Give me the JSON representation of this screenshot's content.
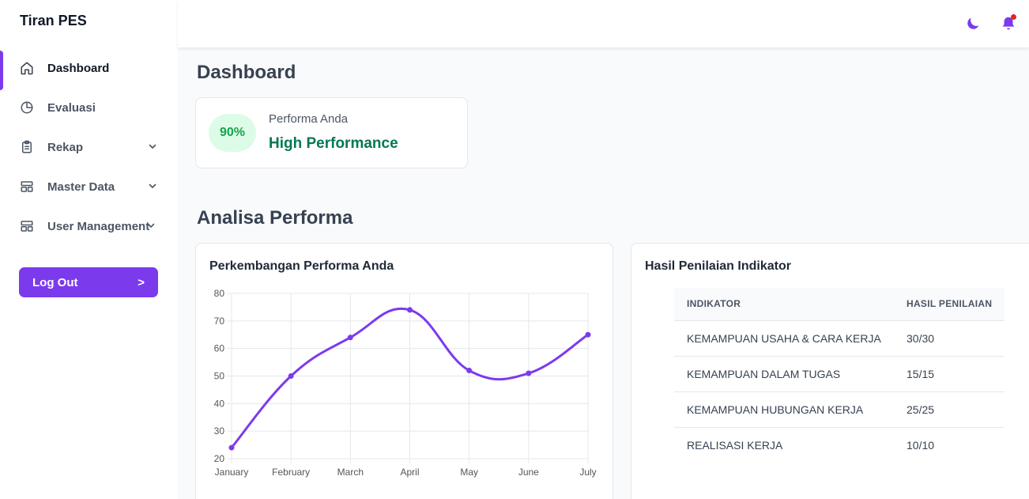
{
  "app": {
    "brand": "Tiran PES"
  },
  "sidebar": {
    "items": [
      {
        "label": "Dashboard",
        "icon": "home-icon",
        "active": true,
        "has_submenu": false
      },
      {
        "label": "Evaluasi",
        "icon": "pie-chart-icon",
        "active": false,
        "has_submenu": false
      },
      {
        "label": "Rekap",
        "icon": "clipboard-icon",
        "active": false,
        "has_submenu": true
      },
      {
        "label": "Master Data",
        "icon": "layout-icon",
        "active": false,
        "has_submenu": true
      },
      {
        "label": "User Management",
        "icon": "layout-icon",
        "active": false,
        "has_submenu": true
      }
    ],
    "logout_label": "Log Out",
    "logout_arrow": ">"
  },
  "topbar": {
    "icons": [
      "moon-icon",
      "bell-icon"
    ],
    "has_notification": true
  },
  "main": {
    "title": "Dashboard",
    "performance": {
      "badge": "90%",
      "label": "Performa Anda",
      "value": "High Performance"
    },
    "section_title": "Analisa Performa",
    "chart_card": {
      "title": "Perkembangan Performa Anda"
    },
    "table_card": {
      "title": "Hasil Penilaian Indikator",
      "headers": [
        "INDIKATOR",
        "HASIL PENILAIAN"
      ],
      "rows": [
        [
          "KEMAMPUAN USAHA & CARA KERJA",
          "30/30"
        ],
        [
          "KEMAMPUAN DALAM TUGAS",
          "15/15"
        ],
        [
          "KEMAMPUAN HUBUNGAN KERJA",
          "25/25"
        ],
        [
          "REALISASI KERJA",
          "10/10"
        ]
      ]
    }
  },
  "colors": {
    "accent": "#7c3aed",
    "success_bg": "#dcfce7",
    "success_text": "#16a34a",
    "notification": "#dc2626"
  },
  "chart_data": {
    "type": "line",
    "categories": [
      "January",
      "February",
      "March",
      "April",
      "May",
      "June",
      "July"
    ],
    "values": [
      24,
      50,
      64,
      74,
      52,
      51,
      65
    ],
    "ylim": [
      20,
      80
    ],
    "yticks": [
      20,
      30,
      40,
      50,
      60,
      70,
      80
    ],
    "grid": true,
    "color": "#7c3aed"
  }
}
